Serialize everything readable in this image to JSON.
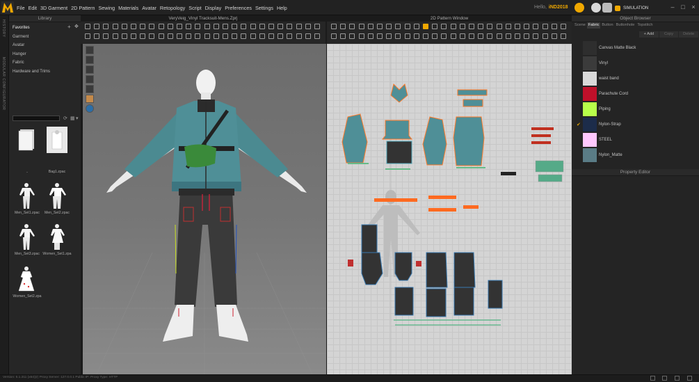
{
  "app": {
    "logo": "Marvelous Designer",
    "menus": [
      "File",
      "Edit",
      "3D Garment",
      "2D Pattern",
      "Sewing",
      "Materials",
      "Avatar",
      "Retopology",
      "Script",
      "Display",
      "Preferences",
      "Settings",
      "Help"
    ],
    "hello_label": "Hello,",
    "user": "iND2018",
    "simulation_label": "SIMULATION"
  },
  "left_strip": {
    "items": [
      "HISTORY",
      "MODULAR CONFIGURATOR"
    ]
  },
  "library": {
    "title": "Library",
    "tree": [
      "Favorites",
      "Garment",
      "Avatar",
      "Hanger",
      "Fabric",
      "Hardware and Trims"
    ],
    "items": [
      {
        "label": ".."
      },
      {
        "label": "Bag1.zpac"
      },
      {
        "label": "Men_Set1.zpac"
      },
      {
        "label": "Men_Set2.zpac"
      },
      {
        "label": "Men_Set3.zpac"
      },
      {
        "label": "Women_Set1.zpa"
      },
      {
        "label": "Women_Set2.zpa"
      }
    ]
  },
  "view3d": {
    "title": "VeryVeig_Vinyl Tracksuit-Mens.Zprj"
  },
  "view2d": {
    "title": "2D Pattern Window"
  },
  "object_browser": {
    "title": "Object Browser",
    "tabs": [
      "Scene",
      "Fabric",
      "Button",
      "Buttonhole",
      "Topstitch"
    ],
    "active_tab": "Fabric",
    "buttons": [
      "+ Add",
      "Copy",
      "Delete"
    ],
    "fabrics": [
      {
        "name": "Canvas Matte Black",
        "color": "#2e2e2e",
        "selected": false
      },
      {
        "name": "Vinyl",
        "color": "#3b3b3b",
        "selected": false
      },
      {
        "name": "waist band",
        "color": "#d9d9d9",
        "selected": false
      },
      {
        "name": "Parachute Cord",
        "color": "#c0102a",
        "selected": false
      },
      {
        "name": "Piping",
        "color": "#b8ff4a",
        "selected": false
      },
      {
        "name": "Nylon-Strap",
        "color": "#1c2c4a",
        "selected": true
      },
      {
        "name": "STEEL",
        "color": "#ffc8ff",
        "selected": false
      },
      {
        "name": "Nylon_Matte",
        "color": "#5a7c86",
        "selected": false
      }
    ]
  },
  "property_editor": {
    "title": "Property Editor"
  },
  "status": {
    "text": "Version: 5.1.311 (x64)(r)   Proxy Server: 127.0.0.1   Public IP:   Proxy Type: HTTP"
  }
}
